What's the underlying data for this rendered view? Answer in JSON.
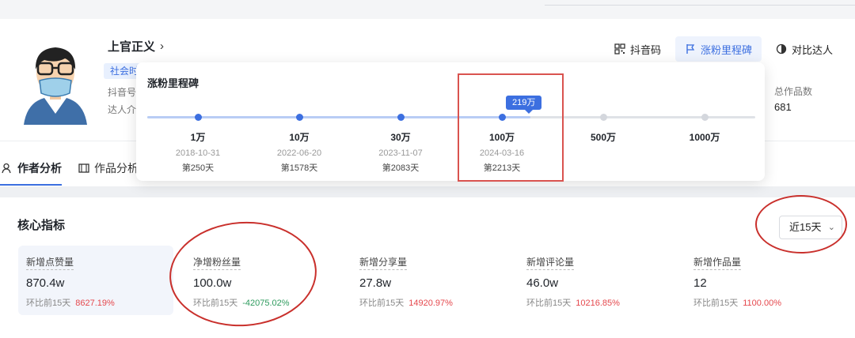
{
  "profile": {
    "name": "上官正义",
    "tag": "社会时",
    "meta_id_label": "抖音号",
    "meta_intro_label": "达人介"
  },
  "actions": [
    {
      "label": "抖音码",
      "icon": "qr-code-icon"
    },
    {
      "label": "涨粉里程碑",
      "icon": "flag-icon",
      "active": true
    },
    {
      "label": "对比达人",
      "icon": "compare-icon"
    }
  ],
  "stats": {
    "works_label": "总作品数",
    "works_value": "681"
  },
  "tabs": [
    {
      "label": "作者分析",
      "icon": "author-icon"
    },
    {
      "label": "作品分析",
      "icon": "video-icon"
    }
  ],
  "milestone": {
    "title": "涨粉里程碑",
    "current_badge": "219万",
    "items": [
      {
        "amount": "1万",
        "date": "2018-10-31",
        "day": "第250天",
        "reached": true
      },
      {
        "amount": "10万",
        "date": "2022-06-20",
        "day": "第1578天",
        "reached": true
      },
      {
        "amount": "30万",
        "date": "2023-11-07",
        "day": "第2083天",
        "reached": true
      },
      {
        "amount": "100万",
        "date": "2024-03-16",
        "day": "第2213天",
        "reached": true
      },
      {
        "amount": "500万",
        "date": "",
        "day": "",
        "reached": false
      },
      {
        "amount": "1000万",
        "date": "",
        "day": "",
        "reached": false
      }
    ]
  },
  "core": {
    "title": "核心指标",
    "period": "近15天",
    "metrics": [
      {
        "label": "新增点赞量",
        "value": "870.4w",
        "compare_label": "环比前15天",
        "change": "8627.19%",
        "trend": "up"
      },
      {
        "label": "净增粉丝量",
        "value": "100.0w",
        "compare_label": "环比前15天",
        "change": "-42075.02%",
        "trend": "down"
      },
      {
        "label": "新增分享量",
        "value": "27.8w",
        "compare_label": "环比前15天",
        "change": "14920.97%",
        "trend": "up"
      },
      {
        "label": "新增评论量",
        "value": "46.0w",
        "compare_label": "环比前15天",
        "change": "10216.85%",
        "trend": "up"
      },
      {
        "label": "新增作品量",
        "value": "12",
        "compare_label": "环比前15天",
        "change": "1100.00%",
        "trend": "up"
      }
    ]
  },
  "colors": {
    "accent": "#3c6fe0",
    "up": "#e5484d",
    "down": "#2e9b5e",
    "annotation": "#c9302c"
  }
}
